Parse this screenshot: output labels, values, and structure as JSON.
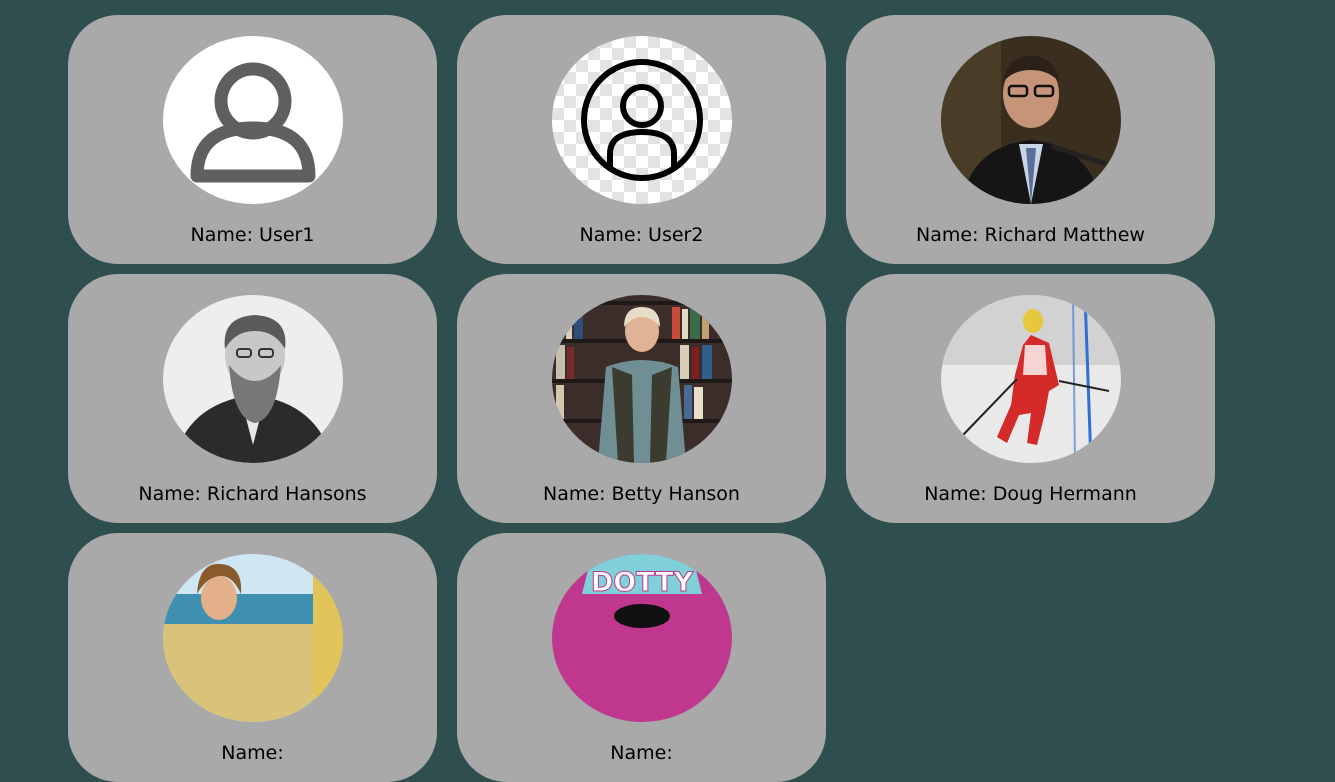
{
  "name_prefix": "Name: ",
  "colors": {
    "page_background": "#2f4f4f",
    "card_background": "#a9a9a9"
  },
  "users": [
    {
      "name": "User1",
      "avatar": "default-user-icon"
    },
    {
      "name": "User2",
      "avatar": "user-circle-icon"
    },
    {
      "name": "Richard Matthew",
      "avatar": "photo-man-speaking-at-microphone"
    },
    {
      "name": "Richard Hansons",
      "avatar": "photo-bearded-man-sepia-portrait"
    },
    {
      "name": "Betty Hanson",
      "avatar": "photo-woman-in-front-of-bookshelves"
    },
    {
      "name": "Doug Hermann",
      "avatar": "photo-slalom-skier"
    },
    {
      "name": "",
      "avatar": "photo-woman-at-beach"
    },
    {
      "name": "",
      "avatar": "dotty-logo"
    }
  ],
  "logo_text": "DOTTY"
}
